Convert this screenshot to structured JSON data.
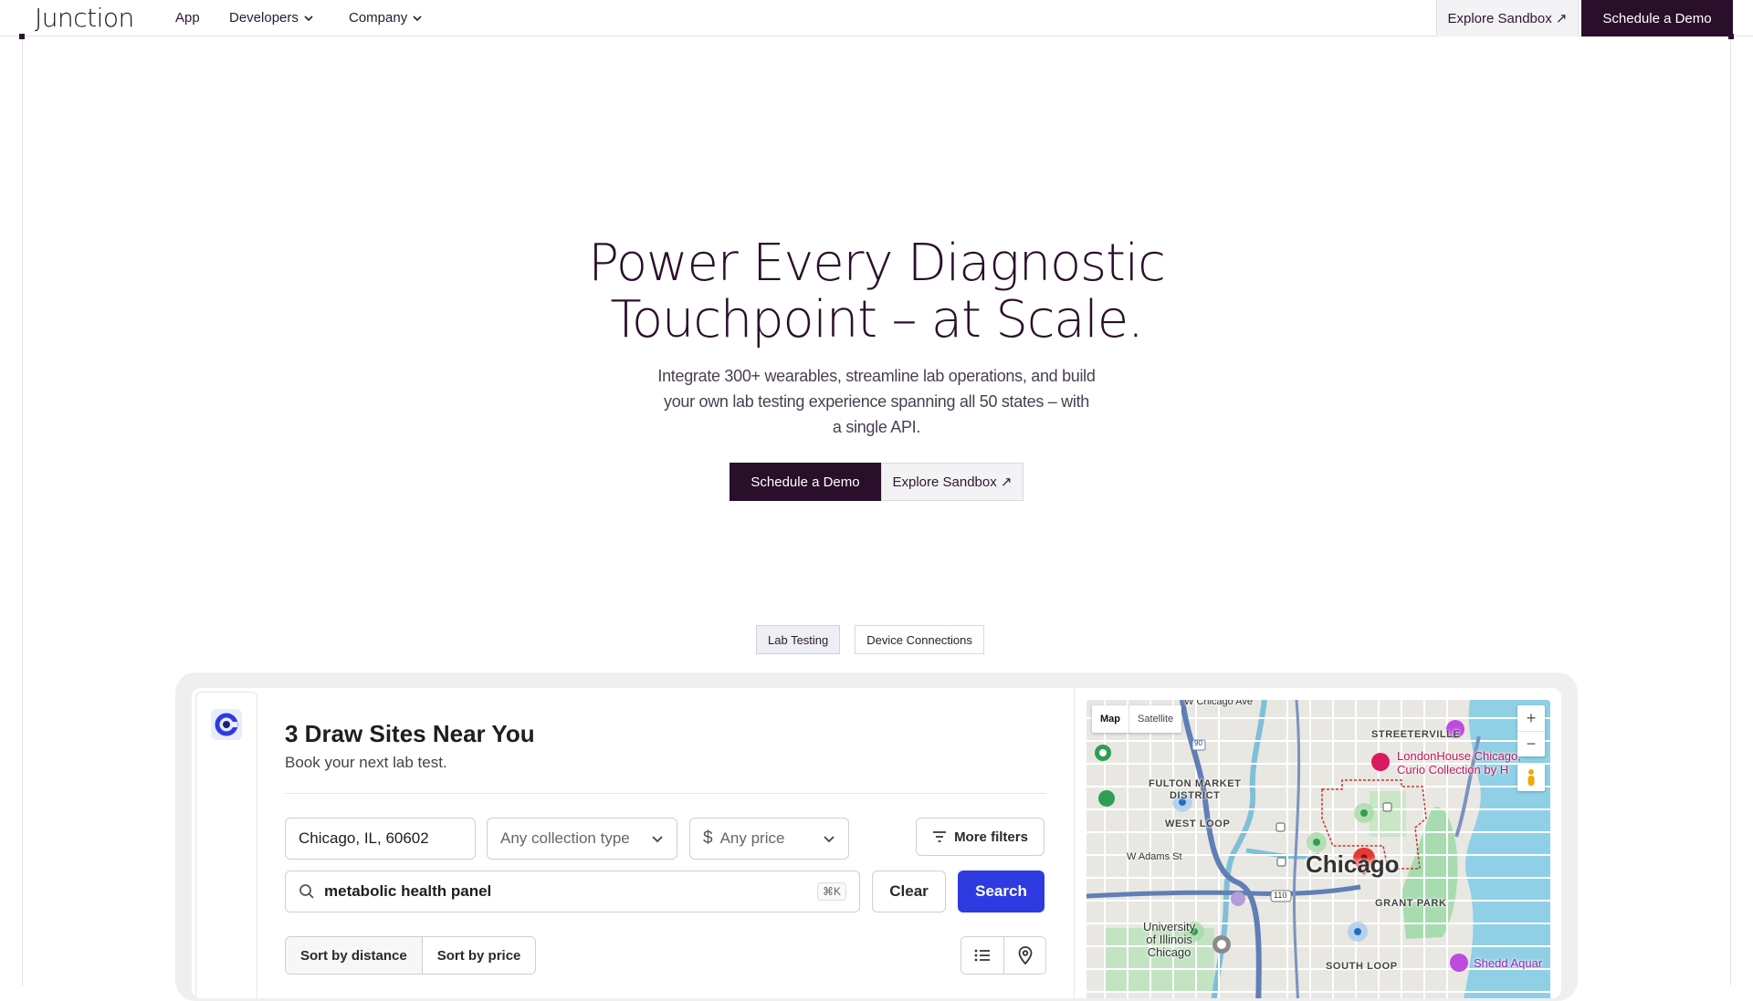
{
  "nav": {
    "logo": "Junction",
    "links": [
      {
        "label": "App"
      },
      {
        "label": "Developers"
      },
      {
        "label": "Company"
      }
    ],
    "sandbox_label": "Explore Sandbox ↗",
    "demo_label": "Schedule a Demo"
  },
  "hero": {
    "title_line1": "Power Every Diagnostic",
    "title_line2": "Touchpoint – at Scale.",
    "subtitle": "Integrate 300+ wearables, streamline lab operations, and build your own lab testing experience spanning all 50 states – with a single API.",
    "demo_label": "Schedule a Demo",
    "sandbox_label": "Explore Sandbox ↗"
  },
  "tabs": [
    {
      "label": "Lab Testing",
      "active": true
    },
    {
      "label": "Device Connections",
      "active": false
    }
  ],
  "demo": {
    "title": "3 Draw Sites Near You",
    "subtitle": "Book your next lab test.",
    "location_value": "Chicago, IL, 60602",
    "collection_type": "Any collection type",
    "price": "Any price",
    "more_filters": "More filters",
    "search_value": "metabolic health panel",
    "search_shortcut": "⌘K",
    "clear_label": "Clear",
    "search_label": "Search",
    "sort_distance": "Sort by distance",
    "sort_price": "Sort by price"
  },
  "map": {
    "mode_map": "Map",
    "mode_satellite": "Satellite",
    "zoom_in": "+",
    "zoom_out": "−",
    "city": "Chicago",
    "labels": {
      "w_chicago_ave": "W Chicago Ave",
      "streeterville": "STREETERVILLE",
      "fulton": "FULTON MARKET\nDISTRICT",
      "west_loop": "WEST LOOP",
      "w_adams": "W Adams St",
      "grant_park": "GRANT PARK",
      "uic": "University\nof Illinois\nChicago",
      "south_loop": "SOUTH LOOP",
      "londonhouse": "LondonHouse Chicago,\nCurio Collection by H",
      "shedd": "Shedd Aquar",
      "route_90": "90",
      "route_110": "110"
    }
  },
  "colors": {
    "brand_dark": "#2a0f2a",
    "primary_blue": "#2d3be0"
  }
}
